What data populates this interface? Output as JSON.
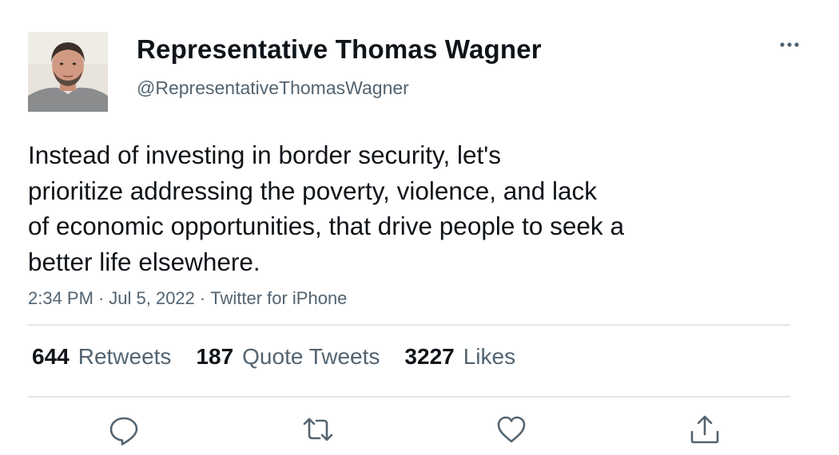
{
  "user": {
    "display_name": "Representative Thomas Wagner",
    "handle": "@RepresentativeThomasWagner",
    "avatar": "profile-photo"
  },
  "tweet": {
    "lines": [
      "Instead of investing in border security, let's",
      "prioritize addressing the poverty, violence, and lack",
      "of economic opportunities, that drive people to seek a",
      "better life elsewhere."
    ],
    "time": "2:34 PM",
    "separator": "·",
    "date": "Jul 5, 2022",
    "source": "Twitter for iPhone"
  },
  "stats": {
    "retweets": {
      "count": "644",
      "label": "Retweets"
    },
    "quotes": {
      "count": "187",
      "label": "Quote Tweets"
    },
    "likes": {
      "count": "3227",
      "label": "Likes"
    }
  },
  "actions": {
    "reply": "reply-icon",
    "retweet": "retweet-icon",
    "like": "heart-icon",
    "share": "share-icon"
  },
  "colors": {
    "text_primary": "#0f1419",
    "text_secondary": "#536471",
    "divider": "#e1e6ea"
  }
}
